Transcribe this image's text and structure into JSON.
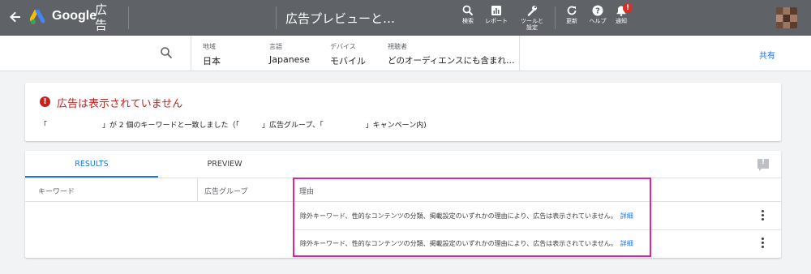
{
  "topbar": {
    "brand": "Google",
    "brand_sub": "広告",
    "page_title": "広告プレビューと…",
    "tools": [
      {
        "label": "検索",
        "icon": "search-icon"
      },
      {
        "label": "レポート",
        "icon": "reports-icon"
      },
      {
        "label": "ツールと設定",
        "icon": "wrench-icon"
      },
      {
        "label": "更新",
        "icon": "refresh-icon"
      },
      {
        "label": "ヘルプ",
        "icon": "help-icon"
      },
      {
        "label": "通知",
        "icon": "bell-icon"
      }
    ],
    "notification_count": "!",
    "colors": {
      "bar": "#5f6368"
    }
  },
  "filters": {
    "location": {
      "label": "地域",
      "value": "日本"
    },
    "language": {
      "label": "言語",
      "value": "Japanese"
    },
    "device": {
      "label": "デバイス",
      "value": "モバイル"
    },
    "audience": {
      "label": "視聴者",
      "value": "どのオーディエンスにも含まれ…"
    },
    "share_label": "共有"
  },
  "alert": {
    "title": "広告は表示されていません",
    "desc_start": "「",
    "desc_mid1": "」が 2 個のキーワードと一致しました（「",
    "desc_mid2": "」広告グループ、「",
    "desc_end": "」キャンペーン内)",
    "color": "#c5221f"
  },
  "results": {
    "tabs": [
      {
        "label": "RESULTS",
        "active": true
      },
      {
        "label": "PREVIEW",
        "active": false
      }
    ],
    "columns": [
      "キーワード",
      "広告グループ",
      "理由"
    ],
    "rows": [
      {
        "keyword": "",
        "ad_group": "",
        "reason": "除外キーワード、性的なコンテンツの分類、掲載設定のいずれかの理由により、広告は表示されていません。",
        "link": "詳細"
      },
      {
        "keyword": "",
        "ad_group": "",
        "reason": "除外キーワード、性的なコンテンツの分類、掲載設定のいずれかの理由により、広告は表示されていません。",
        "link": "詳細"
      }
    ],
    "accent": "#1a73e8",
    "highlight_color": "#e0249a"
  }
}
